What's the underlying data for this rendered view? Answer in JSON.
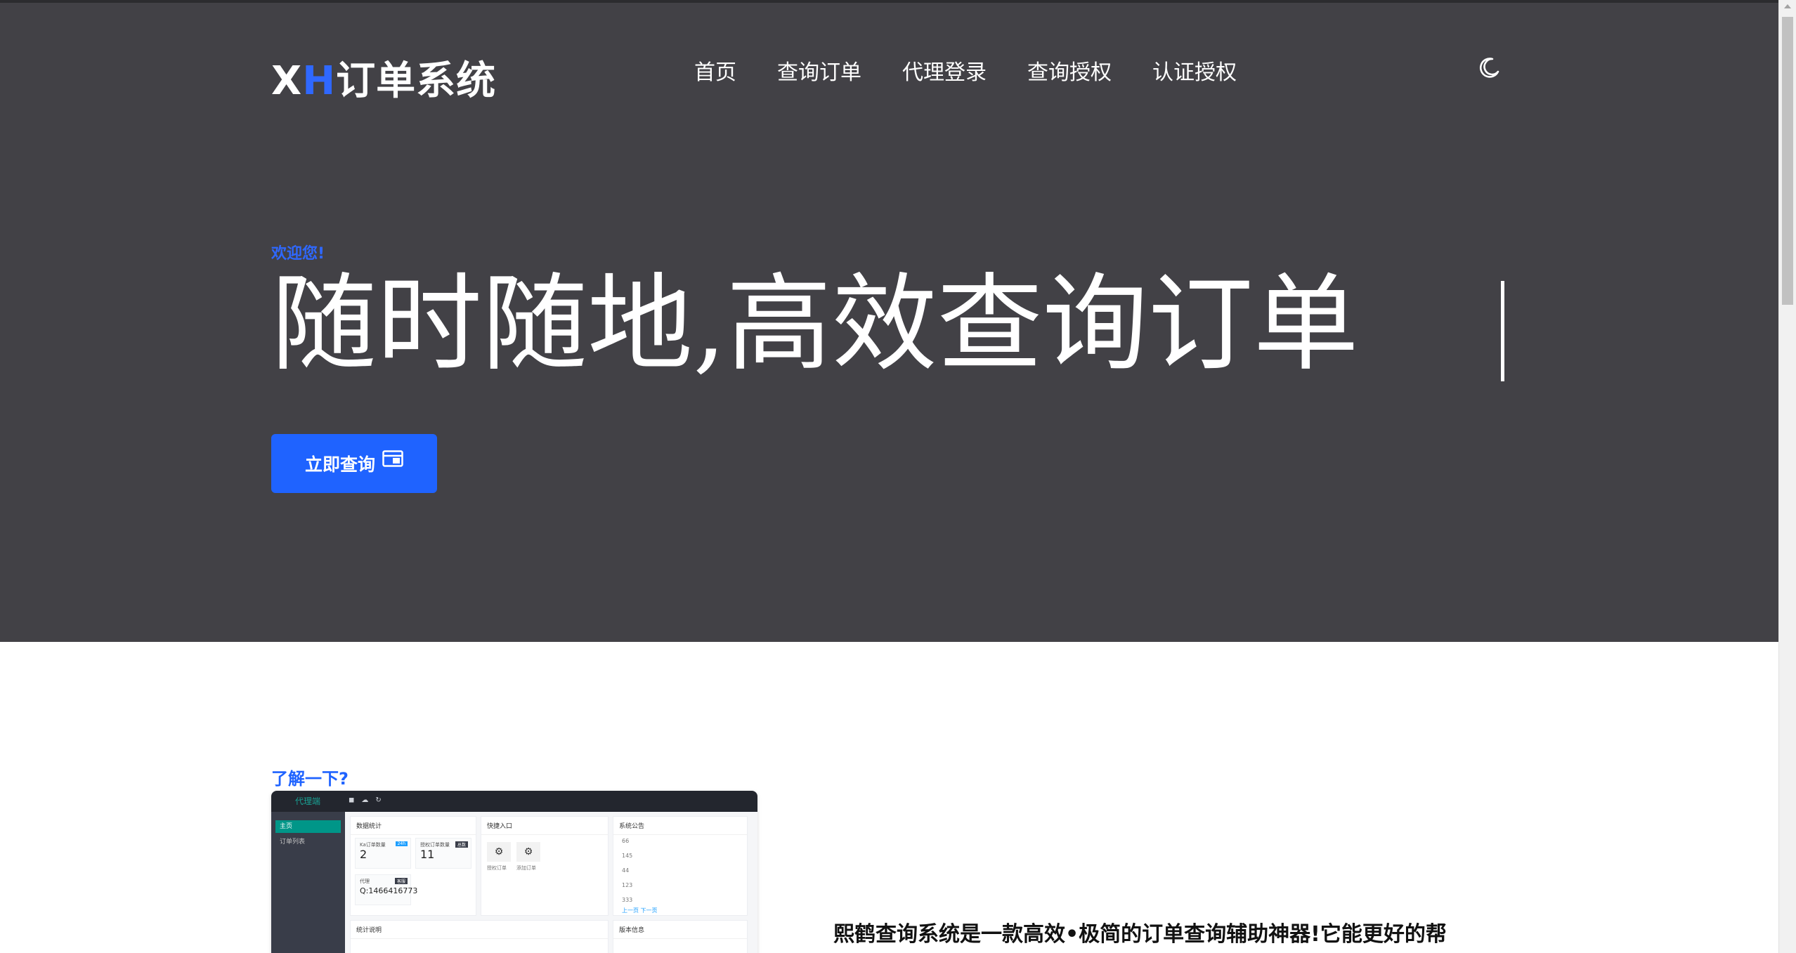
{
  "header": {
    "logo_prefix_x": "X",
    "logo_prefix_h": "H",
    "logo_suffix": "订单系统",
    "nav": [
      "首页",
      "查询订单",
      "代理登录",
      "查询授权",
      "认证授权"
    ],
    "theme_icon": "moon-icon"
  },
  "hero": {
    "welcome": "欢迎您!",
    "headline": "随时随地,高效查询订单",
    "cta_label": "立即查询",
    "cta_icon": "window-icon"
  },
  "about": {
    "learn_more": "了解一下?",
    "intro_text": "熙鹤查询系统是一款高效•极简的订单查询辅助神器!它能更好的帮"
  },
  "preview": {
    "brand": "代理端",
    "sidebar_items": [
      "主页",
      "订单列表"
    ],
    "cards": {
      "stats_title": "数据统计",
      "quick_title": "快捷入口",
      "notice_title": "系统公告",
      "stat1_label": "Ka订单数量",
      "stat1_value": "2",
      "stat1_tag": "24h",
      "stat2_label": "授权订单数量",
      "stat2_value": "11",
      "stat2_tag": "总数",
      "stat3_label": "代理",
      "stat3_value": "Q:1466416773",
      "stat3_tag": "客服",
      "quick1": "授权订单",
      "quick2": "添加订单",
      "notice_list": [
        "66",
        "145",
        "44",
        "123",
        "333"
      ],
      "notice_more": "上一页 下一页",
      "bottom_left_title": "统计说明",
      "bottom_right_title": "版本信息"
    }
  },
  "colors": {
    "hero_bg": "#424146",
    "accent": "#1f63ff",
    "logo_h": "#2f68ff"
  }
}
